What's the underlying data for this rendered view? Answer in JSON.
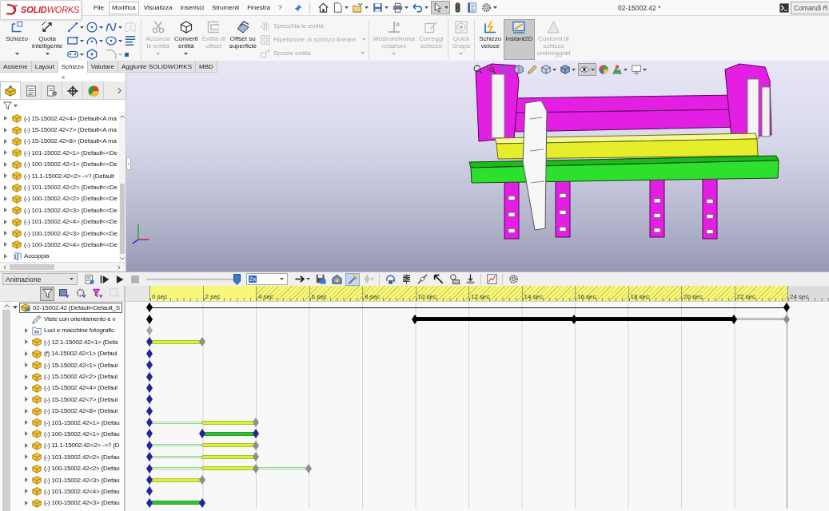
{
  "logo": "**SOLID**WORKS",
  "menu": [
    {
      "label": "File",
      "selected": false
    },
    {
      "label": "Modifica",
      "selected": true
    },
    {
      "label": "Visualizza",
      "selected": false
    },
    {
      "label": "Inserisci",
      "selected": false
    },
    {
      "label": "Strumenti",
      "selected": false
    },
    {
      "label": "Finestra",
      "selected": false
    },
    {
      "label": "?",
      "selected": false
    }
  ],
  "quick_access": {
    "select_on": true
  },
  "document_title": "02-15002.42 *",
  "command_search": {
    "placeholder": "Comandi R"
  },
  "ribbon": [
    {
      "items": [
        {
          "kind": "sketch",
          "label": "Schizzo",
          "dropdown": true,
          "disabled": false,
          "selected": false
        },
        {
          "kind": "dimension",
          "label": "Quota intelligente",
          "dropdown": true,
          "disabled": false,
          "selected": false
        },
        {
          "kind": "grid",
          "tools": [
            {
              "kind": "line",
              "dropdown": true,
              "disabled": false
            },
            {
              "kind": "circle",
              "dropdown": true,
              "disabled": false
            },
            {
              "kind": "spline",
              "dropdown": true,
              "disabled": false
            },
            {
              "kind": "plane",
              "dropdown": false,
              "disabled": true
            },
            {
              "kind": "rectangle",
              "dropdown": true,
              "disabled": false
            },
            {
              "kind": "arc",
              "dropdown": true,
              "disabled": false
            },
            {
              "kind": "ellipse",
              "dropdown": true,
              "disabled": false
            },
            {
              "kind": "text",
              "dropdown": false,
              "disabled": false
            },
            {
              "kind": "slot",
              "dropdown": true,
              "disabled": false
            },
            {
              "kind": "polygon",
              "dropdown": false,
              "disabled": false
            },
            {
              "kind": "fillet",
              "dropdown": true,
              "disabled": true
            },
            {
              "kind": "point",
              "dropdown": false,
              "disabled": false
            }
          ]
        }
      ]
    },
    {
      "items": [
        {
          "kind": "trim",
          "label": "Accorcia le entità",
          "dropdown": true,
          "disabled": true,
          "selected": false
        },
        {
          "kind": "convert",
          "label": "Converti entità",
          "dropdown": true,
          "disabled": false,
          "selected": false
        },
        {
          "kind": "offset",
          "label": "Entità di offset",
          "dropdown": false,
          "disabled": true,
          "selected": false
        },
        {
          "kind": "surfaceoffset",
          "label": "Offset su superficie",
          "dropdown": false,
          "disabled": false,
          "selected": false
        },
        {
          "kind": "stack",
          "rows": [
            {
              "kind": "mirror",
              "label": "Specchia le entità",
              "dropdown": false,
              "disabled": true
            },
            {
              "kind": "pattern",
              "label": "Ripetizione di schizzo lineare",
              "dropdown": true,
              "disabled": true
            },
            {
              "kind": "move",
              "label": "Sposta entità",
              "dropdown": true,
              "disabled": true
            }
          ]
        }
      ]
    },
    {
      "items": [
        {
          "kind": "relations",
          "label": "Mostra/elimina relazioni",
          "dropdown": true,
          "disabled": true,
          "selected": false
        },
        {
          "kind": "repair",
          "label": "Correggi schizzo",
          "dropdown": false,
          "disabled": true,
          "selected": false
        }
      ]
    },
    {
      "items": [
        {
          "kind": "snaps",
          "label": "Quick Snaps",
          "dropdown": true,
          "disabled": true,
          "selected": false
        }
      ]
    },
    {
      "items": [
        {
          "kind": "rapid",
          "label": "Schizzo veloce",
          "dropdown": false,
          "disabled": false,
          "selected": false
        },
        {
          "kind": "instant2d",
          "label": "Instant2D",
          "dropdown": false,
          "disabled": false,
          "selected": true
        },
        {
          "kind": "shaded",
          "label": "Contorni di schizzo ombreggiati",
          "dropdown": false,
          "disabled": true,
          "selected": false
        }
      ]
    }
  ],
  "command_tabs": [
    {
      "label": "Assieme",
      "selected": false
    },
    {
      "label": "Layout",
      "selected": false
    },
    {
      "label": "Schizzo",
      "selected": true
    },
    {
      "label": "Valutare",
      "selected": false
    },
    {
      "label": "Aggiunte SOLIDWORKS",
      "selected": false
    },
    {
      "label": "MBD",
      "selected": false
    }
  ],
  "feature_manager": {
    "tabs": [
      {
        "kind": "features",
        "selected": true
      },
      {
        "kind": "properties",
        "selected": false
      },
      {
        "kind": "configurations",
        "selected": false
      },
      {
        "kind": "dimxpert",
        "selected": false
      },
      {
        "kind": "display",
        "selected": false
      }
    ],
    "tree": [
      {
        "kind": "part",
        "label": "(-) 15-15002.42<4> (Default<A ma",
        "expanded": false
      },
      {
        "kind": "part",
        "label": "(-) 15-15002.42<7> (Default<A ma",
        "expanded": false
      },
      {
        "kind": "part",
        "label": "(-) 15-15002.42<8> (Default<A ma",
        "expanded": false
      },
      {
        "kind": "part",
        "label": "(-) 101-15002.42<1> (Default<<De",
        "expanded": false
      },
      {
        "kind": "part",
        "label": "(-) 100-15002.42<1> (Default<<De",
        "expanded": false
      },
      {
        "kind": "part",
        "label": "(-) 11.1-15002.42<2> ->? (Default",
        "expanded": false
      },
      {
        "kind": "part",
        "label": "(-) 101-15002.42<2> (Default<<De",
        "expanded": false
      },
      {
        "kind": "part",
        "label": "(-) 100-15002.42<2> (Default<<De",
        "expanded": false
      },
      {
        "kind": "part",
        "label": "(-) 101-15002.42<3> (Default<<De",
        "expanded": false
      },
      {
        "kind": "part",
        "label": "(-) 101-15002.42<4> (Default<<De",
        "expanded": false
      },
      {
        "kind": "part",
        "label": "(-) 100-15002.42<3> (Default<<De",
        "expanded": false
      },
      {
        "kind": "part",
        "label": "(-) 100-15002.42<4> (Default<<De",
        "expanded": false
      },
      {
        "kind": "mates",
        "label": "Accoppia",
        "expanded": false
      }
    ]
  },
  "viewport": {
    "hide_show_on": true
  },
  "animation": {
    "study": "Animazione",
    "controls": [
      {
        "kind": "calculate",
        "disabled": false
      },
      {
        "kind": "start",
        "disabled": false
      },
      {
        "kind": "play",
        "disabled": false
      },
      {
        "kind": "stop",
        "disabled": true
      }
    ],
    "playback": {
      "level": 0.96
    },
    "speed": "2x",
    "tools": [
      {
        "kind": "playmode",
        "selected": false,
        "disabled": false,
        "dropdown": true
      },
      {
        "kind": "save",
        "selected": false,
        "disabled": false
      },
      {
        "kind": "wizard",
        "selected": false,
        "disabled": false
      },
      {
        "kind": "autokey",
        "selected": true,
        "disabled": false
      },
      {
        "kind": "addkey",
        "selected": false,
        "disabled": true
      },
      {
        "kind": "motor",
        "selected": false,
        "disabled": false
      },
      {
        "kind": "spring",
        "selected": false,
        "disabled": false
      },
      {
        "kind": "damper",
        "selected": false,
        "disabled": false
      },
      {
        "kind": "force",
        "selected": false,
        "disabled": false
      },
      {
        "kind": "contact",
        "selected": false,
        "disabled": false
      },
      {
        "kind": "gravity",
        "selected": false,
        "disabled": false
      },
      {
        "kind": "results",
        "selected": false,
        "disabled": false
      },
      {
        "kind": "options",
        "selected": false,
        "disabled": false
      }
    ],
    "filters": [
      {
        "kind": "all",
        "selected": true,
        "disabled": false
      },
      {
        "kind": "animated",
        "selected": false,
        "disabled": false
      },
      {
        "kind": "driving",
        "selected": false,
        "disabled": false
      },
      {
        "kind": "chosen",
        "selected": false,
        "disabled": false
      },
      {
        "kind": "results",
        "selected": false,
        "disabled": true
      }
    ],
    "ruler": [
      {
        "label": "0 sec",
        "hatched": false
      },
      {
        "label": "2 sec",
        "hatched": false
      },
      {
        "label": "4 sec",
        "hatched": true
      },
      {
        "label": "6 sec",
        "hatched": true
      },
      {
        "label": "8 sec",
        "hatched": true
      },
      {
        "label": "10 sec",
        "hatched": true
      },
      {
        "label": "12 sec",
        "hatched": true
      },
      {
        "label": "14 sec",
        "hatched": true
      },
      {
        "label": "16 sec",
        "hatched": true
      },
      {
        "label": "18 sec",
        "hatched": true
      },
      {
        "label": "20 sec",
        "hatched": true
      },
      {
        "label": "22 sec",
        "hatched": true
      },
      {
        "label": "24 sec",
        "hatched": false
      }
    ],
    "tree": [
      {
        "kind": "assembly",
        "label": "02-15002.42 (Default<Default_S",
        "expanded": true,
        "selected": true,
        "keys": [
          {
            "level": 0,
            "color": "#000000",
            "segments": [
              {
                "kind": "line",
                "color": "#1a1a1a"
              }
            ]
          },
          {
            "level": 1,
            "color": "#000000"
          }
        ],
        "children": [
          {
            "kind": "views",
            "label": "Viste con orientamento e v",
            "selected": false,
            "keys": [
              {
                "level": 0,
                "color": "#000000"
              },
              {
                "level": 0.4167,
                "color": "#000000",
                "segments": [
                  {
                    "kind": "solid",
                    "color": "#000000"
                  }
                ]
              },
              {
                "level": 0.6667,
                "color": "#000000",
                "segments": [
                  {
                    "kind": "solid",
                    "color": "#000000"
                  }
                ]
              },
              {
                "level": 0.9167,
                "color": "#000000",
                "segments": [
                  {
                    "kind": "hollow",
                    "color": "#9a9a9a"
                  }
                ]
              },
              {
                "level": 1,
                "color": "#8f8f8f"
              }
            ]
          },
          {
            "kind": "lights",
            "label": "Luci e macchine fotografic",
            "expanded": false,
            "selected": false,
            "keys": [
              {
                "level": 0,
                "color": "#a8a8a8"
              }
            ]
          },
          {
            "kind": "part",
            "label": "(-) 12.1-15002.42<1> (Defa",
            "expanded": false,
            "selected": false,
            "keys": [
              {
                "level": 0,
                "color": "#23239b",
                "segments": [
                  {
                    "kind": "solid",
                    "color": "#dcef3c"
                  }
                ]
              },
              {
                "level": 0.0833,
                "color": "#8f8f8f"
              }
            ]
          },
          {
            "kind": "part",
            "label": "(f) 14-15002.42<1> (Defaul",
            "expanded": false,
            "selected": false,
            "keys": [
              {
                "level": 0,
                "color": "#23239b"
              }
            ]
          },
          {
            "kind": "part",
            "label": "(-) 15-15002.42<1> (Defaul",
            "expanded": false,
            "selected": false,
            "keys": [
              {
                "level": 0,
                "color": "#23239b"
              }
            ]
          },
          {
            "kind": "part",
            "label": "(-) 15-15002.42<2> (Defaul",
            "expanded": false,
            "selected": false,
            "keys": [
              {
                "level": 0,
                "color": "#23239b"
              }
            ]
          },
          {
            "kind": "part",
            "label": "(-) 15-15002.42<4> (Defaul",
            "expanded": false,
            "selected": false,
            "keys": [
              {
                "level": 0,
                "color": "#23239b"
              }
            ]
          },
          {
            "kind": "part",
            "label": "(-) 15-15002.42<7> (Defaul",
            "expanded": false,
            "selected": false,
            "keys": [
              {
                "level": 0,
                "color": "#23239b"
              }
            ]
          },
          {
            "kind": "part",
            "label": "(-) 15-15002.42<8> (Defaul",
            "expanded": false,
            "selected": false,
            "keys": [
              {
                "level": 0,
                "color": "#23239b"
              }
            ]
          },
          {
            "kind": "part",
            "label": "(-) 101-15002.42<1> (Defau",
            "expanded": false,
            "selected": false,
            "keys": [
              {
                "level": 0,
                "color": "#23239b",
                "segments": [
                  {
                    "kind": "hollow",
                    "color": "#8ed88a"
                  },
                  {
                    "kind": "solid",
                    "color": "#dcef3c"
                  }
                ]
              },
              {
                "level": 0.1667,
                "color": "#8f8f8f"
              }
            ]
          },
          {
            "kind": "part",
            "label": "(-) 100-15002.42<1> (Defau",
            "expanded": false,
            "selected": false,
            "keys": [
              {
                "level": 0,
                "color": "#23239b"
              },
              {
                "level": 0.0833,
                "color": "#23239b",
                "segments": [
                  {
                    "kind": "solid",
                    "color": "#33c033"
                  }
                ]
              },
              {
                "level": 0.1667,
                "color": "#23239b"
              }
            ]
          },
          {
            "kind": "part",
            "label": "(-) 11.1-15002.42<2> ->? (D",
            "expanded": false,
            "selected": false,
            "keys": [
              {
                "level": 0,
                "color": "#23239b",
                "segments": [
                  {
                    "kind": "hollow",
                    "color": "#8ed88a"
                  },
                  {
                    "kind": "solid",
                    "color": "#dcef3c"
                  }
                ]
              },
              {
                "level": 0.1667,
                "color": "#8f8f8f"
              }
            ]
          },
          {
            "kind": "part",
            "label": "(-) 101-15002.42<2> (Defau",
            "expanded": false,
            "selected": false,
            "keys": [
              {
                "level": 0,
                "color": "#23239b",
                "segments": [
                  {
                    "kind": "hollow",
                    "color": "#8ed88a"
                  },
                  {
                    "kind": "solid",
                    "color": "#dcef3c"
                  }
                ]
              },
              {
                "level": 0.1667,
                "color": "#8f8f8f"
              }
            ]
          },
          {
            "kind": "part",
            "label": "(-) 100-15002.42<2> (Defau",
            "expanded": false,
            "selected": false,
            "keys": [
              {
                "level": 0,
                "color": "#23239b",
                "segments": [
                  {
                    "kind": "hollow",
                    "color": "#8ed88a"
                  },
                  {
                    "kind": "solid",
                    "color": "#dcef3c"
                  }
                ]
              },
              {
                "level": 0.1667,
                "color": "#8f8f8f",
                "segments": [
                  {
                    "kind": "hollow",
                    "color": "#8ed88a"
                  }
                ]
              },
              {
                "level": 0.25,
                "color": "#8f8f8f"
              }
            ]
          },
          {
            "kind": "part",
            "label": "(-) 101-15002.42<3> (Defau",
            "expanded": false,
            "selected": false,
            "keys": [
              {
                "level": 0,
                "color": "#23239b",
                "segments": [
                  {
                    "kind": "solid",
                    "color": "#dcef3c"
                  }
                ]
              },
              {
                "level": 0.0833,
                "color": "#8f8f8f"
              }
            ]
          },
          {
            "kind": "part",
            "label": "(-) 101-15002.42<4> (Defau",
            "expanded": false,
            "selected": false,
            "keys": [
              {
                "level": 0,
                "color": "#23239b"
              }
            ]
          },
          {
            "kind": "part",
            "label": "(-) 100-15002.42<3> (Defau",
            "expanded": false,
            "selected": false,
            "keys": [
              {
                "level": 0,
                "color": "#23239b",
                "segments": [
                  {
                    "kind": "solid",
                    "color": "#33c033"
                  }
                ]
              },
              {
                "level": 0.0833,
                "color": "#23239b"
              }
            ]
          }
        ]
      }
    ]
  }
}
